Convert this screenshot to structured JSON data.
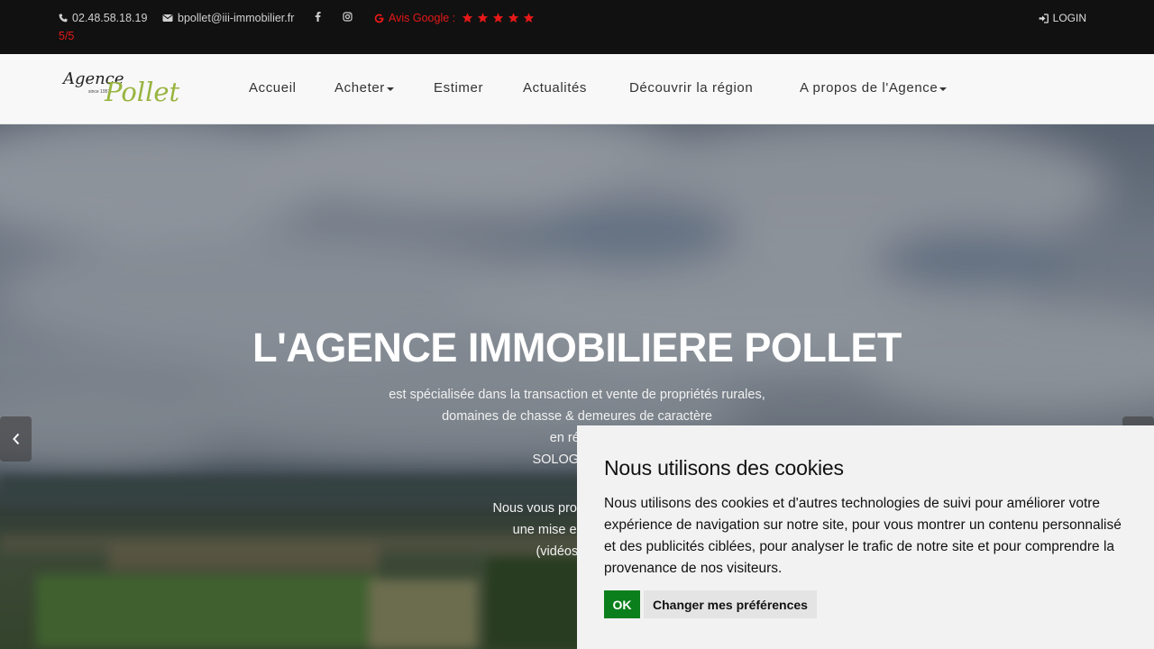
{
  "topbar": {
    "phone": "02.48.58.18.19",
    "email": "bpollet@iii-immobilier.fr",
    "social": [
      "facebook-icon",
      "instagram-icon"
    ],
    "google_label": "Avis Google :",
    "google_stars": 5,
    "google_score": "5/5",
    "login_label": "LOGIN",
    "accent_color": "#e51818"
  },
  "logo": {
    "line1": "Agence",
    "since": "since 1957",
    "line2": "Pollet"
  },
  "nav": {
    "items": [
      {
        "label": "Accueil"
      },
      {
        "label": "Acheter"
      },
      {
        "label": "Estimer"
      },
      {
        "label": "Actualités"
      },
      {
        "label": "Découvrir la région"
      },
      {
        "label": "A propos de l'Agence"
      }
    ]
  },
  "hero": {
    "title": "L'AGENCE IMMOBILIERE POLLET",
    "lines": [
      "est spécialisée dans la transaction et vente de propriétés rurales,",
      "domaines de chasse & demeures de caractère",
      "en région",
      "SOLOGNE, BE"
    ],
    "lines2": [
      "Nous vous proposons, dans l",
      "une mise en valeur de",
      "(vidéos, photo"
    ]
  },
  "cookie": {
    "title": "Nous utilisons des cookies",
    "body": "Nous utilisons des cookies et d'autres technologies de suivi pour améliorer votre expérience de navigation sur notre site, pour vous montrer un contenu personnalisé et des publicités ciblées, pour analyser le trafic de notre site et pour comprendre la provenance de nos visiteurs.",
    "ok_label": "OK",
    "pref_label": "Changer mes préférences",
    "ok_color": "#0a7f1c"
  }
}
